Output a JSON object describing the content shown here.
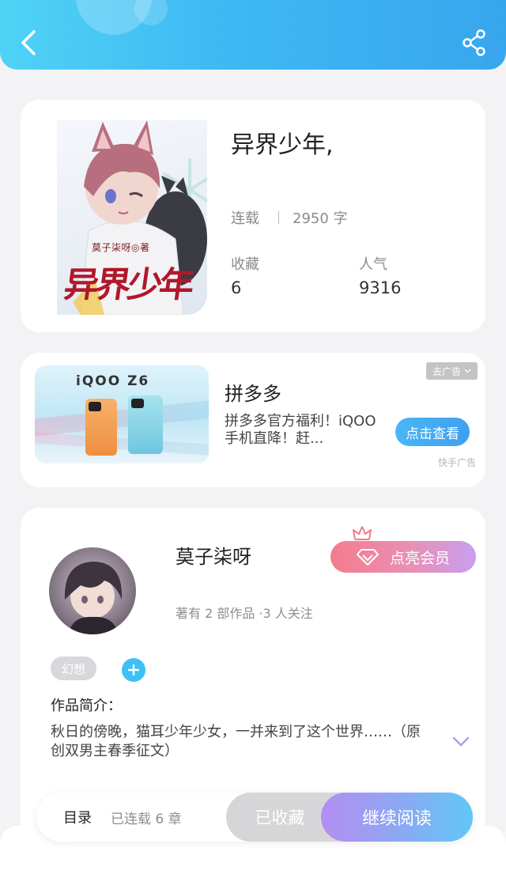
{
  "header": {
    "back_icon": "back-arrow-icon",
    "share_icon": "share-icon",
    "gradient_colors": [
      "#4fd3f6",
      "#38a6ee"
    ]
  },
  "book": {
    "title": "异界少年,",
    "status": "连载",
    "word_count": "2950 字",
    "favorites_label": "收藏",
    "favorites_value": "6",
    "popularity_label": "人气",
    "popularity_value": "9316",
    "cover": {
      "author_text": "莫子柒呀◎著",
      "title_text": "异界少年"
    }
  },
  "ad": {
    "image_brand": "iQOO Z6",
    "title": "拼多多",
    "description": "拼多多官方福利！iQOO 手机直降！赶...",
    "dismiss_label": "去广告",
    "cta_label": "点击查看",
    "source": "快手广告"
  },
  "author": {
    "name": "莫子柒呀",
    "vip_label": "点亮会员",
    "meta": "著有 2 部作品 ·3 人关注",
    "tag": "幻想",
    "intro_label": "作品简介：",
    "intro_text": "秋日的傍晚，猫耳少年少女，一并来到了这个世界……（原创双男主春季征文）"
  },
  "bottom_bar": {
    "toc_label": "目录",
    "chapters_label": "已连载 6 章",
    "favorited_label": "已收藏",
    "read_label": "继续阅读",
    "read_gradient": [
      "#b38ef2",
      "#5fc7f4"
    ]
  }
}
